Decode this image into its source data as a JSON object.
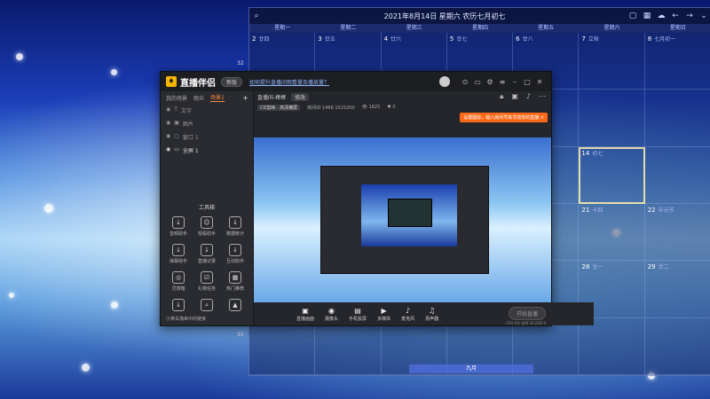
{
  "calendar": {
    "title": "2021年8月14日 星期六 农历七月初七",
    "weekdays": [
      "星期一",
      "星期二",
      "星期三",
      "星期四",
      "星期五",
      "星期六",
      "星期日"
    ],
    "cells": [
      {
        "d": "2",
        "l": "廿四"
      },
      {
        "d": "3",
        "l": "廿五"
      },
      {
        "d": "4",
        "l": "廿六"
      },
      {
        "d": "5",
        "l": "廿七"
      },
      {
        "d": "6",
        "l": "廿八"
      },
      {
        "d": "7",
        "l": "立秋"
      },
      {
        "d": "8",
        "l": "七月初一"
      },
      {
        "d": "",
        "l": ""
      },
      {
        "d": "",
        "l": ""
      },
      {
        "d": "",
        "l": ""
      },
      {
        "d": "",
        "l": ""
      },
      {
        "d": "",
        "l": ""
      },
      {
        "d": "",
        "l": ""
      },
      {
        "d": "",
        "l": ""
      },
      {
        "d": "",
        "l": ""
      },
      {
        "d": "",
        "l": ""
      },
      {
        "d": "",
        "l": ""
      },
      {
        "d": "",
        "l": ""
      },
      {
        "d": "",
        "l": ""
      },
      {
        "d": "14",
        "l": "初七"
      },
      {
        "d": "",
        "l": ""
      },
      {
        "d": "",
        "l": ""
      },
      {
        "d": "",
        "l": ""
      },
      {
        "d": "",
        "l": ""
      },
      {
        "d": "",
        "l": ""
      },
      {
        "d": "",
        "l": ""
      },
      {
        "d": "21",
        "l": "十四"
      },
      {
        "d": "22",
        "l": "中元节"
      },
      {
        "d": "",
        "l": ""
      },
      {
        "d": "",
        "l": ""
      },
      {
        "d": "",
        "l": ""
      },
      {
        "d": "",
        "l": ""
      },
      {
        "d": "",
        "l": ""
      },
      {
        "d": "28",
        "l": "廿一"
      },
      {
        "d": "29",
        "l": "廿二"
      },
      {
        "d": "",
        "l": ""
      },
      {
        "d": "",
        "l": ""
      },
      {
        "d": "",
        "l": ""
      },
      {
        "d": "",
        "l": ""
      },
      {
        "d": "",
        "l": ""
      },
      {
        "d": "",
        "l": ""
      },
      {
        "d": "",
        "l": ""
      }
    ],
    "week_numbers": [
      "32",
      "34",
      "35"
    ],
    "month_label": "九月"
  },
  "app": {
    "logo": "直播伴侣",
    "version": "新版",
    "notice": "如何提升直播间观看量及播放量？",
    "tabs": [
      "我的场景",
      "观众",
      "场景1"
    ],
    "active_tab": "场景1",
    "scenes": [
      "文字",
      "图片",
      "窗口 1",
      "全屏 1"
    ],
    "tools_title": "工具箱",
    "tools": [
      "音频助手",
      "观看助手",
      "数据统计",
      "弹幕助手",
      "直播记录",
      "互动助手",
      "灵感箱",
      "礼物任务",
      "热门推荐",
      "",
      "",
      ""
    ],
    "sidebar_footer": "小黄车撸串中的链接",
    "room_name": "直播间-棒棒",
    "room_btn": "修改",
    "category": "CD剪映 · 高清横屏",
    "room_id": "房间ID 1466  1515200",
    "viewers": "1625",
    "likes": "0",
    "tip": "设置图标，输入房间号来寻找你的直播  ×",
    "controls": [
      {
        "icon": "▣",
        "label": "直播画面"
      },
      {
        "icon": "◉",
        "label": "摄像头"
      },
      {
        "icon": "▤",
        "label": "手机投屏"
      },
      {
        "icon": "▶",
        "label": "多媒体"
      },
      {
        "icon": "♪",
        "label": "麦克风"
      },
      {
        "icon": "♫",
        "label": "扬声器"
      }
    ],
    "start": "开始直播",
    "stats": "CPU:0% 帧率:30 码率:0"
  }
}
